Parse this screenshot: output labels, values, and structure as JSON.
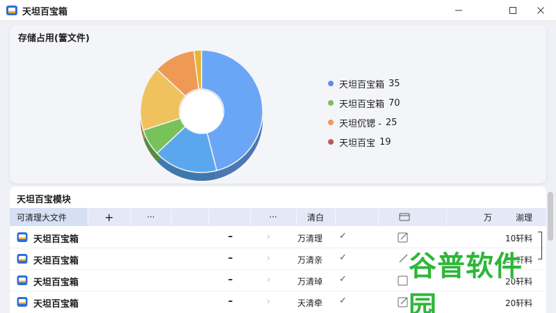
{
  "window": {
    "title": "天坦百宝箱"
  },
  "storage": {
    "title": "存储占用(簹文件)",
    "legend": [
      {
        "label": "天坦百宝箱",
        "value": "35",
        "color": "#5b8def"
      },
      {
        "label": "天坦百宝箱",
        "value": "70",
        "color": "#7cbf56"
      },
      {
        "label": "天坦伔锶 -",
        "value": "25",
        "color": "#f1965a"
      },
      {
        "label": "天坦百宝",
        "value": "19",
        "color": "#b55a5a"
      }
    ]
  },
  "chart_data": {
    "type": "pie",
    "style": "donut-3d",
    "title": "存储占用(簹文件)",
    "slices": [
      {
        "label": "blue",
        "value": 46,
        "color": "#6aa6f6"
      },
      {
        "label": "light-blue",
        "value": 17,
        "color": "#5aa7ee"
      },
      {
        "label": "green",
        "value": 7,
        "color": "#77c25a"
      },
      {
        "label": "yellow",
        "value": 17,
        "color": "#efc25e"
      },
      {
        "label": "orange",
        "value": 11,
        "color": "#ee9a55"
      },
      {
        "label": "gold",
        "value": 2,
        "color": "#e9b431"
      }
    ]
  },
  "modules": {
    "title": "天坦百宝模块",
    "header": {
      "first": "可清理大文件",
      "plus": "+",
      "dots1": "···",
      "dots2": "···",
      "clean": "清白",
      "col_ti": "万",
      "col_last": "湔理"
    },
    "rows": [
      {
        "name": "天坦百宝箱",
        "dash": "–",
        "clean": "万清理",
        "size": "10轩料"
      },
      {
        "name": "天坦百宝箱",
        "dash": "–",
        "clean": "万清亲",
        "size": "10轩料"
      },
      {
        "name": "天坦百宝箱",
        "dash": "–",
        "clean": "万清琸",
        "size": "20轩料"
      },
      {
        "name": "天坦百宝箱",
        "dash": "–",
        "clean": "天清牵",
        "size": "20轩料"
      }
    ]
  },
  "watermark": {
    "text": "谷普软件园"
  }
}
